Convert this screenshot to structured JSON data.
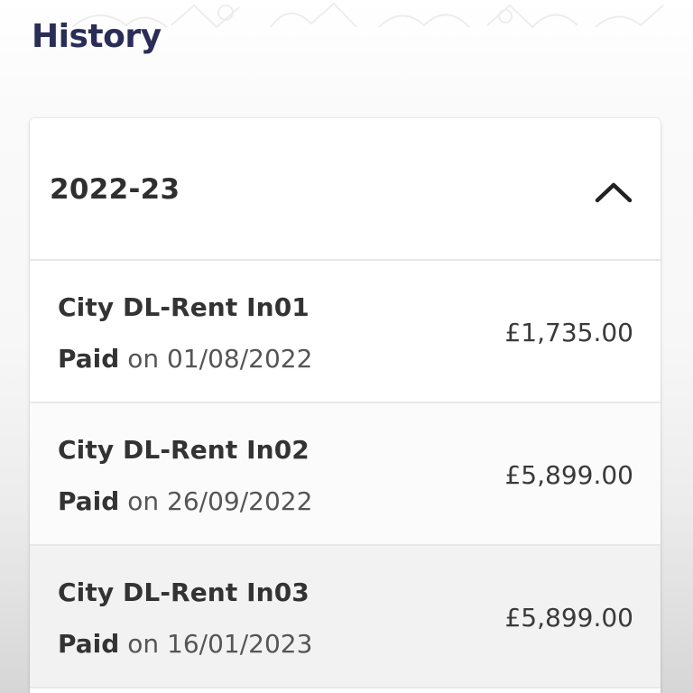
{
  "page": {
    "title": "History"
  },
  "history": {
    "year": "2022-23",
    "toggle_icon": "chevron-up-icon",
    "items": [
      {
        "name": "City DL-Rent In01",
        "status": "Paid",
        "date_prefix": "on",
        "date": "01/08/2022",
        "amount": "£1,735.00"
      },
      {
        "name": "City DL-Rent In02",
        "status": "Paid",
        "date_prefix": "on",
        "date": "26/09/2022",
        "amount": "£5,899.00"
      },
      {
        "name": "City DL-Rent In03",
        "status": "Paid",
        "date_prefix": "on",
        "date": "16/01/2023",
        "amount": "£5,899.00"
      }
    ]
  },
  "colors": {
    "title": "#2a2d57",
    "card_background": "#ffffff",
    "divider": "#e6e6e6",
    "text_primary": "#333333",
    "text_secondary": "#555555"
  }
}
